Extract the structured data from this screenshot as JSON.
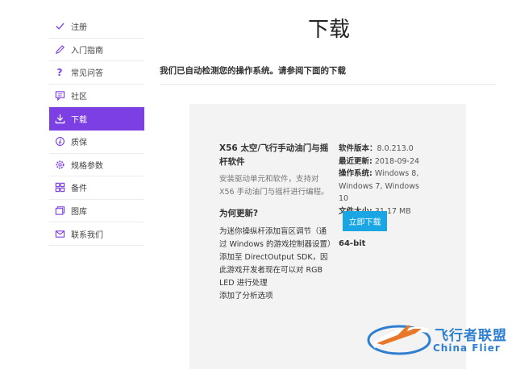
{
  "sidebar": {
    "items": [
      {
        "label": "注册",
        "icon": "check-icon"
      },
      {
        "label": "入门指南",
        "icon": "pencil-icon"
      },
      {
        "label": "常见问答",
        "icon": "question-icon"
      },
      {
        "label": "社区",
        "icon": "chat-icon"
      },
      {
        "label": "下载",
        "icon": "download-icon",
        "active": true
      },
      {
        "label": "质保",
        "icon": "warranty-icon"
      },
      {
        "label": "规格参数",
        "icon": "gear-icon"
      },
      {
        "label": "备件",
        "icon": "grid-icon"
      },
      {
        "label": "图库",
        "icon": "gallery-icon"
      },
      {
        "label": "联系我们",
        "icon": "mail-icon"
      }
    ]
  },
  "page": {
    "title": "下载",
    "subtitle": "我们已自动检测您的操作系统。请参阅下面的下载"
  },
  "product": {
    "title": "X56 太空/飞行手动油门与摇杆软件",
    "description": "安装驱动单元和软件，支持对X56 手动油门与摇杆进行编程。",
    "why_heading": "为何更新?",
    "why_lines": [
      "为迷你操纵杆添加盲区调节（通过 Windows 的游戏控制器设置）",
      "添加至 DirectOutput SDK，因此游戏开发者现在可以对 RGB LED 进行处理",
      "添加了分析选项"
    ]
  },
  "details": {
    "version_label": "软件版本：",
    "version": "8.0.213.0",
    "updated_label": "最近更新:",
    "updated": "2018-09-24",
    "os_label": "操作系统:",
    "os": "Windows 8, Windows 7, Windows 10",
    "size_label": "文件大小:",
    "size": "31.17 MB",
    "download_label": "立即下载",
    "bitness": "64-bit"
  },
  "watermark": {
    "cn": "飞行者联盟",
    "en": "China Flier"
  },
  "colors": {
    "accent": "#7b3fe4",
    "button": "#1aa6e4",
    "watermark": "#2f7fd0"
  }
}
